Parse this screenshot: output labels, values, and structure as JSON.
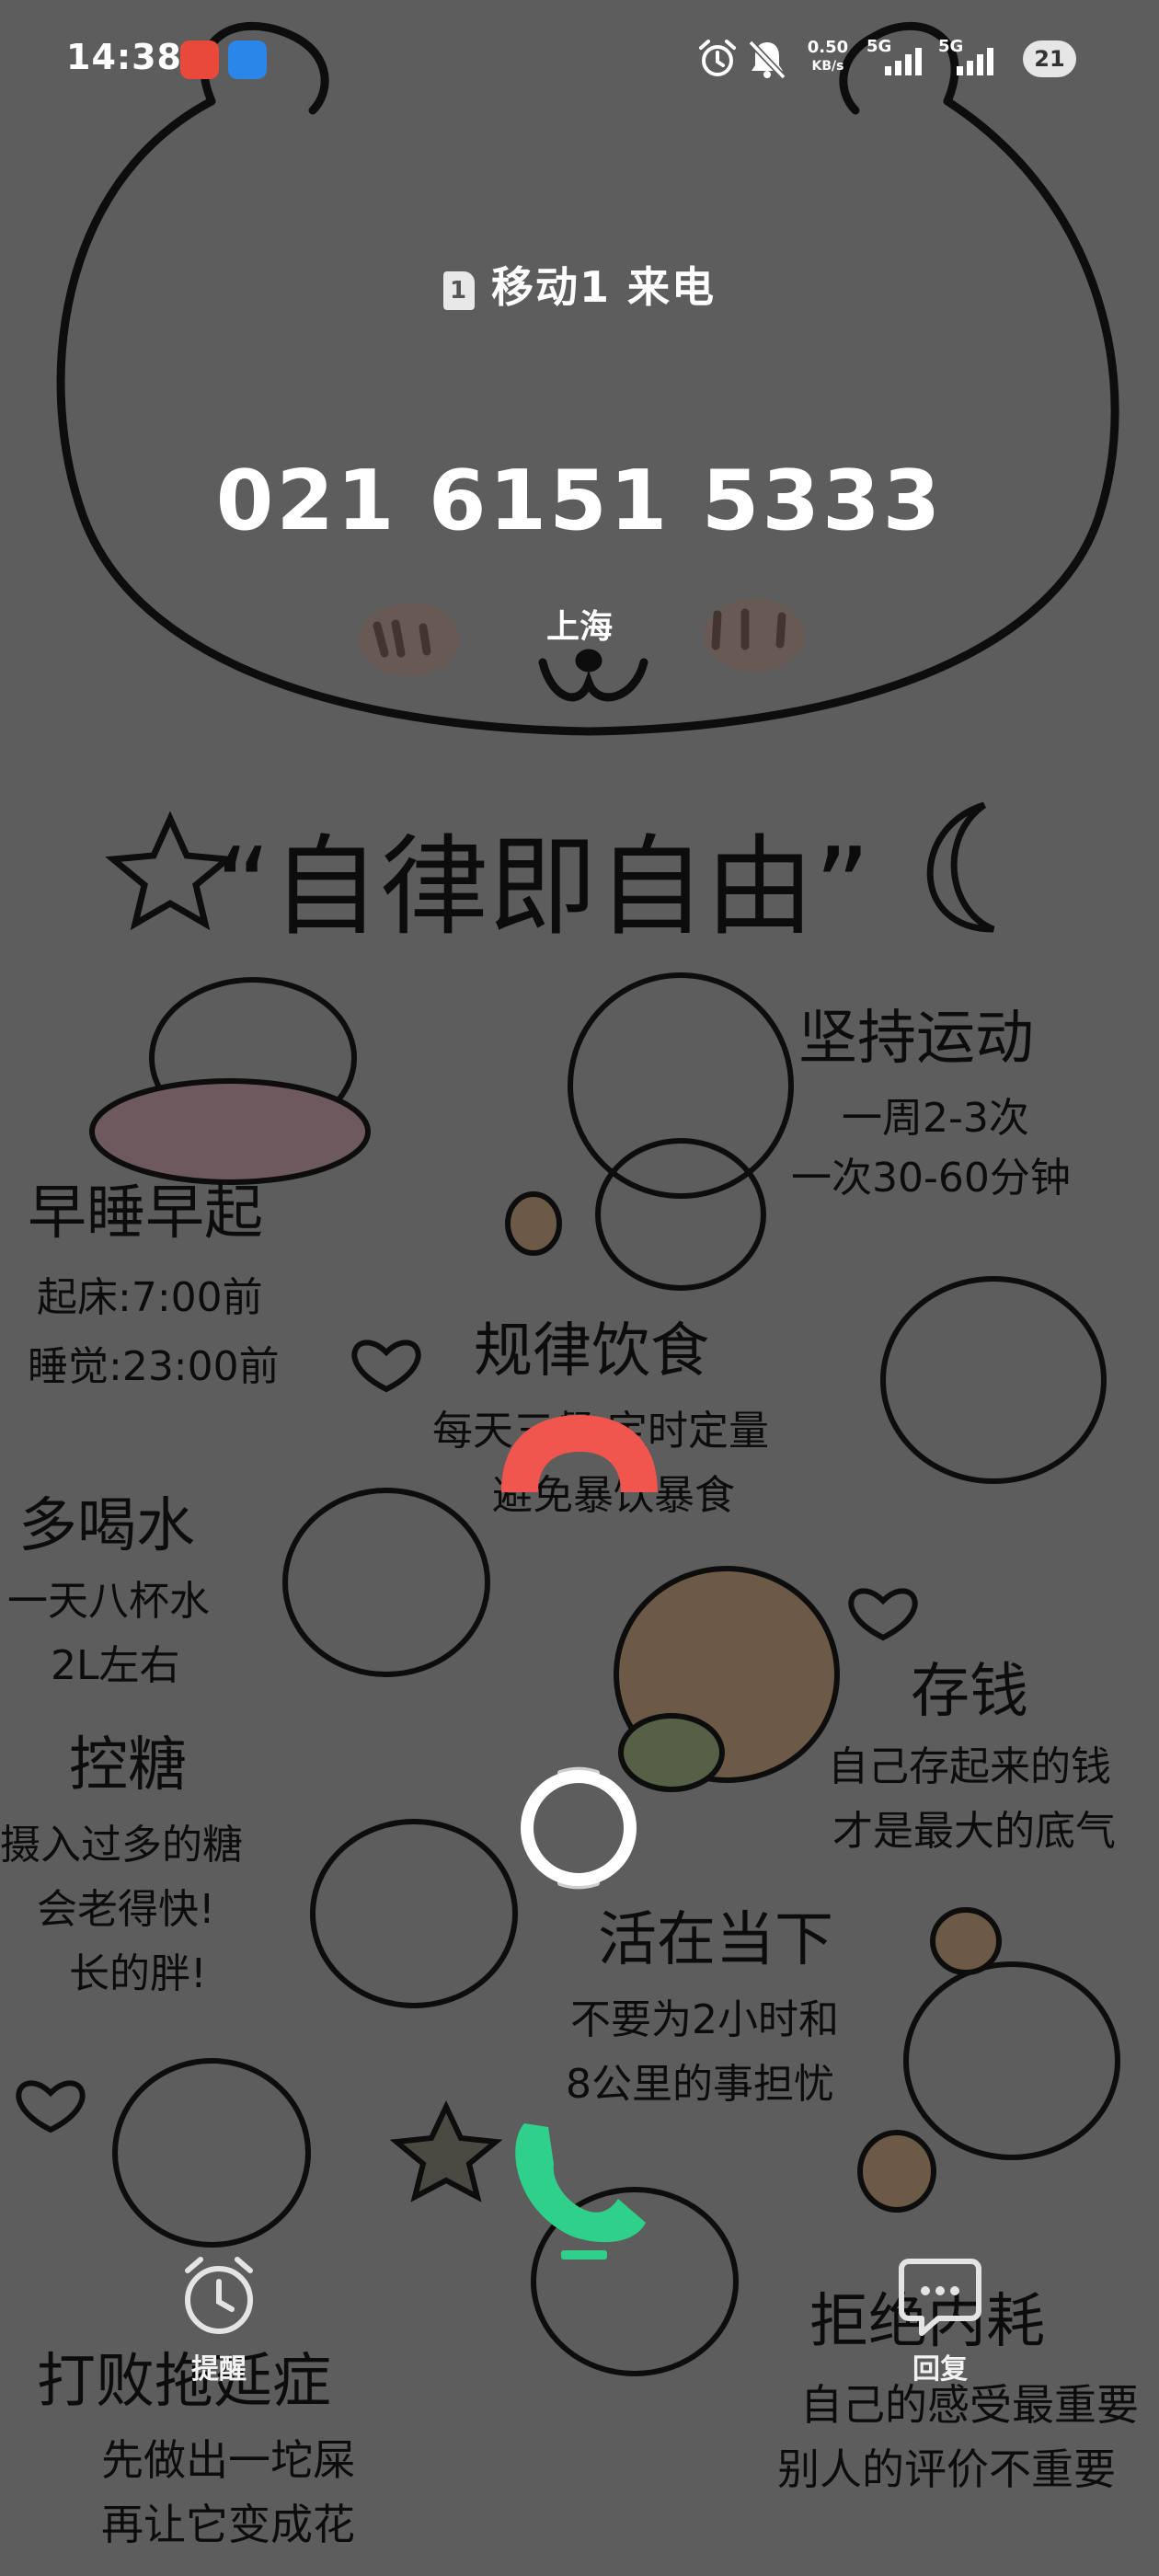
{
  "status_bar": {
    "time": "14:38",
    "net_speed_value": "0.50",
    "net_speed_unit": "KB/s",
    "sim1_network": "5G",
    "sim2_network": "5G",
    "battery": "21",
    "icons": [
      "app-badge-icon",
      "app-badge-icon",
      "alarm-icon",
      "mute-bell-icon",
      "signal-icon",
      "signal-icon",
      "battery-icon"
    ]
  },
  "call": {
    "sim_number": "1",
    "caller_line": "移动1 来电",
    "phone_number": "021 6151 5333",
    "location": "上海",
    "colors": {
      "decline": "#f0564d",
      "answer": "#2fd08a",
      "handle": "#ffffff"
    }
  },
  "actions": {
    "reminder_label": "提醒",
    "reply_label": "回复"
  },
  "wallpaper": {
    "title": "“自律即自由”",
    "sections": [
      {
        "heading": "早睡早起",
        "lines": [
          "起床:7:00前",
          "睡觉:23:00前"
        ]
      },
      {
        "heading": "坚持运动",
        "lines": [
          "一周2-3次",
          "一次30-60分钟"
        ]
      },
      {
        "heading": "规律饮食",
        "lines": [
          "每天三餐 定时定量",
          "避免暴饮暴食"
        ]
      },
      {
        "heading": "多喝水",
        "lines": [
          "一天八杯水",
          "2L左右"
        ]
      },
      {
        "heading": "存钱",
        "lines": [
          "自己存起来的钱",
          "才是最大的底气"
        ]
      },
      {
        "heading": "控糖",
        "lines": [
          "摄入过多的糖",
          "会老得快!",
          "长的胖!"
        ]
      },
      {
        "heading": "活在当下",
        "lines": [
          "不要为2小时和",
          "8公里的事担忧"
        ]
      },
      {
        "heading": "打败拖延症",
        "lines": [
          "先做出一坨屎",
          "再让它变成花"
        ]
      },
      {
        "heading": "拒绝内耗",
        "lines": [
          "自己的感受最重要",
          "别人的评价不重要"
        ]
      }
    ]
  }
}
